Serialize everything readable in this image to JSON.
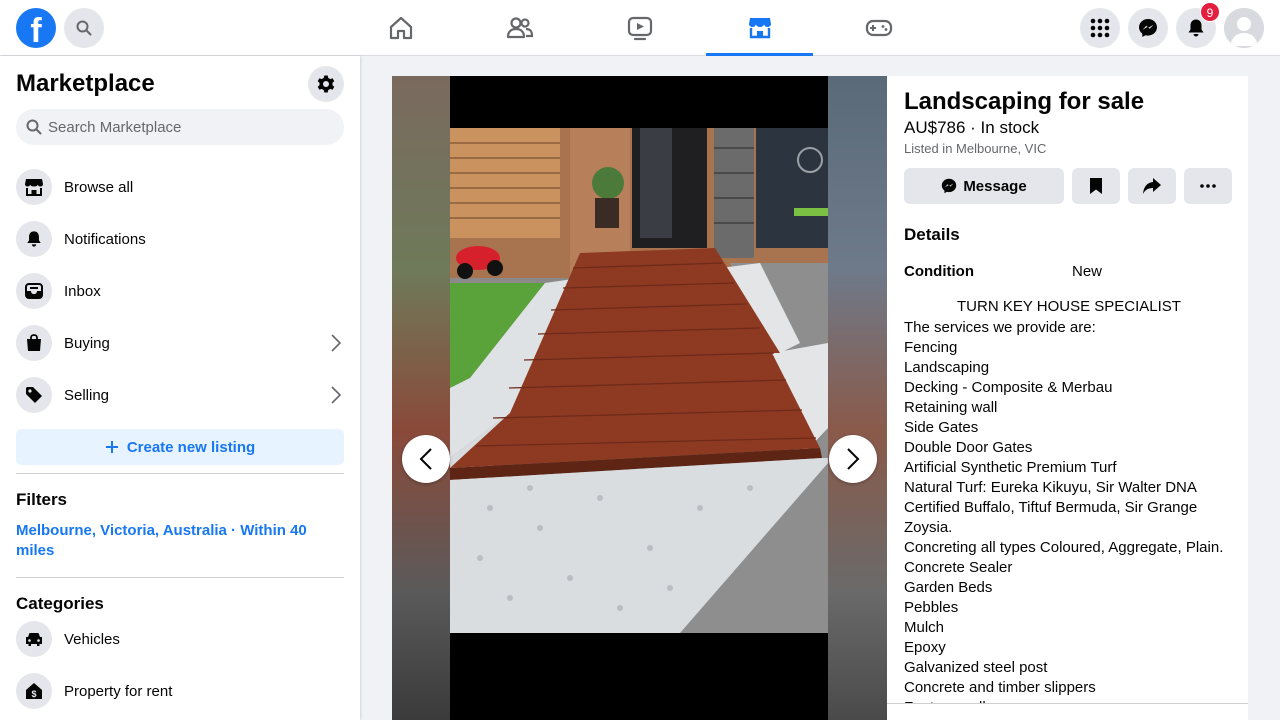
{
  "topbar": {
    "logo_letter": "f",
    "notifications_count": "9",
    "active_tab": "marketplace"
  },
  "sidebar": {
    "title": "Marketplace",
    "search_placeholder": "Search Marketplace",
    "items": [
      {
        "label": "Browse all",
        "icon": "storefront-icon"
      },
      {
        "label": "Notifications",
        "icon": "bell-icon"
      },
      {
        "label": "Inbox",
        "icon": "inbox-icon"
      },
      {
        "label": "Buying",
        "icon": "shopping-bag-icon"
      },
      {
        "label": "Selling",
        "icon": "price-tag-icon"
      }
    ],
    "create_label": "Create new listing",
    "filters_title": "Filters",
    "filter_location": "Melbourne, Victoria, Australia · Within 40 miles",
    "categories_title": "Categories",
    "categories": [
      {
        "label": "Vehicles",
        "icon": "car-icon"
      },
      {
        "label": "Property for rent",
        "icon": "house-dollar-icon"
      }
    ]
  },
  "listing": {
    "title": "Landscaping for sale",
    "price_stock": "AU$786 · In stock",
    "location": "Listed in Melbourne, VIC",
    "message_label": "Message",
    "details_title": "Details",
    "condition_label": "Condition",
    "condition_value": "New",
    "description_heading": "TURN KEY HOUSE SPECIALIST",
    "description_lines": [
      "The services we provide are:",
      "Fencing",
      "Landscaping",
      "Decking - Composite & Merbau",
      "Retaining wall",
      "Side Gates",
      "Double Door Gates",
      "Artificial Synthetic Premium Turf",
      "Natural Turf: Eureka Kikuyu, Sir Walter DNA",
      "Certified Buffalo, Tiftuf Bermuda, Sir Grange",
      "Zoysia.",
      "Concreting all types Coloured, Aggregate, Plain.",
      "Concrete Sealer",
      "Garden Beds",
      "Pebbles",
      "Mulch",
      "Epoxy",
      "Galvanized steel post",
      "Concrete and timber slippers",
      "Feature wall"
    ]
  },
  "colors": {
    "brand": "#1877f2",
    "badge": "#e41e3f"
  }
}
